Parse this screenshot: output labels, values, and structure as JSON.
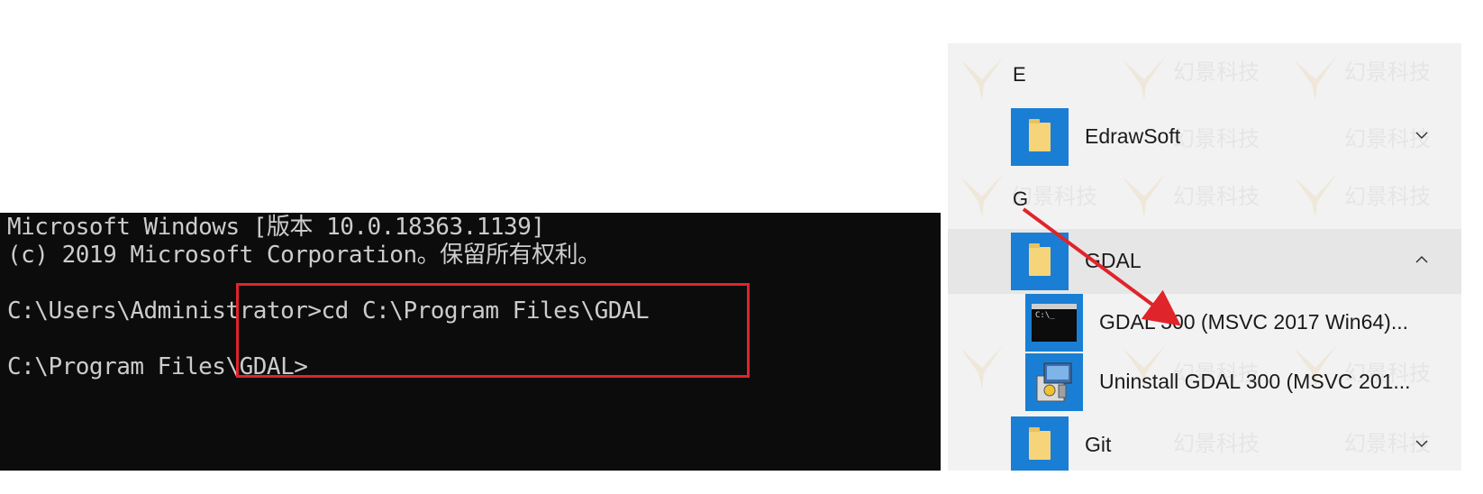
{
  "console": {
    "lines": [
      "Microsoft Windows [版本 10.0.18363.1139]",
      "(c) 2019 Microsoft Corporation。保留所有权利。",
      "",
      "C:\\Users\\Administrator>cd C:\\Program Files\\GDAL",
      "",
      "C:\\Program Files\\GDAL>"
    ]
  },
  "start_menu": {
    "watermark_text": "幻景科技",
    "groups": [
      {
        "letter": "E"
      },
      {
        "letter": "G"
      }
    ],
    "items": [
      {
        "label": "EdrawSoft",
        "icon": "folder-icon",
        "state": "collapsed"
      },
      {
        "label": "GDAL",
        "icon": "folder-icon",
        "state": "expanded"
      },
      {
        "label": "Git",
        "icon": "folder-icon",
        "state": "collapsed"
      }
    ],
    "gdal_children": [
      {
        "label": "GDAL 300 (MSVC 2017 Win64)...",
        "icon": "command-prompt-icon"
      },
      {
        "label": "Uninstall GDAL 300 (MSVC 201...",
        "icon": "installer-icon"
      }
    ]
  },
  "colors": {
    "console_bg": "#0c0c0c",
    "console_text": "#cccccc",
    "highlight": "#e0242b",
    "tile_blue": "#1a7fd4",
    "menu_bg": "#f2f2f2"
  }
}
